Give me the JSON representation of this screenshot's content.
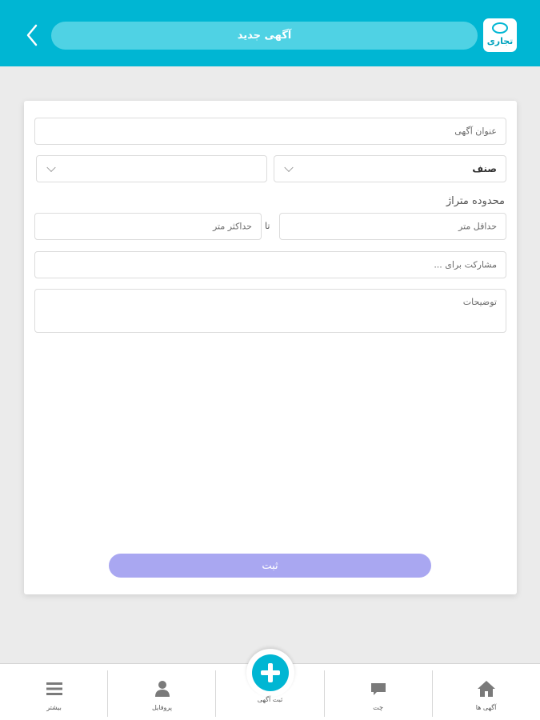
{
  "header": {
    "title": "آگهی جدید",
    "logo_text": "تجاری",
    "accent_color": "#00b6d3",
    "back_icon": "chevron-left-icon"
  },
  "form": {
    "title_placeholder": "عنوان آگهی",
    "category_label": "صنف",
    "second_select_value": "",
    "area_label": "محدوده متراژ",
    "min_area_placeholder": "حداقل متر",
    "to_label": "تا",
    "max_area_placeholder": "حداکثر متر",
    "partnership_placeholder": "مشارکت برای ...",
    "description_placeholder": "توضیحات",
    "submit_label": "ثبت",
    "submit_color": "#a9a7f1"
  },
  "bottom_nav": {
    "items": [
      {
        "label": "آگهی ها",
        "icon": "home-icon"
      },
      {
        "label": "چت",
        "icon": "chat-icon"
      },
      {
        "label": "ثبت آگهی",
        "icon": "plus-icon"
      },
      {
        "label": "پروفایل",
        "icon": "user-icon"
      },
      {
        "label": "بیشتر",
        "icon": "menu-icon"
      }
    ]
  }
}
